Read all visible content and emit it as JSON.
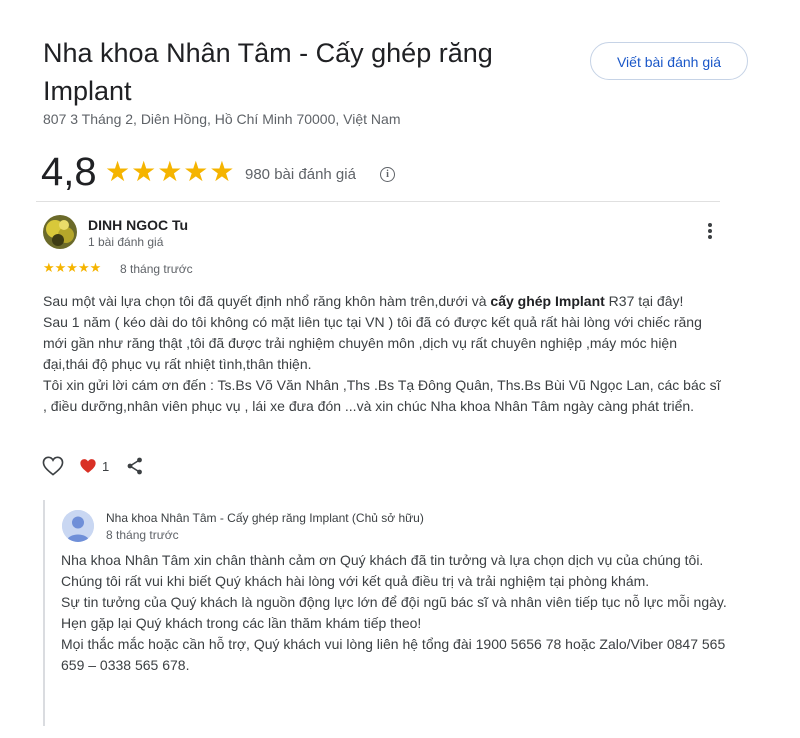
{
  "place": {
    "title": "Nha khoa Nhân Tâm - Cấy ghép răng Implant",
    "address": "807 3 Tháng 2, Diên Hồng, Hồ Chí Minh 70000, Việt Nam",
    "rating": "4,8",
    "stars": "★★★★★",
    "review_count": "980 bài đánh giá",
    "write_review_label": "Viết bài đánh giá",
    "info_glyph": "i"
  },
  "review": {
    "author": "DINH NGOC Tu",
    "author_meta": "1 bài đánh giá",
    "stars": "★★★★★",
    "rating_value": 5,
    "date": "8 tháng trước",
    "text_part1": "Sau một vài lựa chọn tôi đã quyết định nhổ răng khôn hàm trên,dưới và ",
    "text_bold": "cấy ghép Implant",
    "text_part2": " R37 tại đây!",
    "text_line2": "Sau 1 năm ( kéo dài do tôi không có mặt liên tục tại VN ) tôi đã có được kết quả rất hài lòng với chiếc răng mới gần như răng thật ,tôi đã được trải nghiệm chuyên môn ,dịch vụ rất chuyên nghiệp ,máy móc hiện đại,thái độ phục vụ rất nhiệt tình,thân thiện.",
    "text_line3": "Tôi xin gửi lời cám ơn đến : Ts.Bs Võ Văn Nhân ,Ths .Bs Tạ Đông Quân, Ths.Bs Bùi Vũ Ngọc Lan, các bác sĩ , điều dưỡng,nhân viên phục vụ , lái xe đưa đón ...và xin chúc Nha khoa Nhân Tâm ngày càng phát triển.",
    "like_count": "1"
  },
  "owner_reply": {
    "author": "Nha khoa Nhân Tâm - Cấy ghép răng Implant (Chủ sở hữu)",
    "date": "8 tháng trước",
    "lines": [
      "Nha khoa Nhân Tâm xin chân thành cảm ơn Quý khách đã tin tưởng và lựa chọn dịch vụ của chúng tôi.",
      "Chúng tôi rất vui khi biết Quý khách hài lòng với kết quả điều trị và trải nghiệm tại phòng khám.",
      "Sự tin tưởng của Quý khách là nguồn động lực lớn để đội ngũ bác sĩ và nhân viên tiếp tục nỗ lực mỗi ngày.",
      "Hẹn gặp lại Quý khách trong các lần thăm khám tiếp theo!",
      "Mọi thắc mắc hoặc cần hỗ trợ, Quý khách vui lòng liên hệ tổng đài 1900 5656 78 hoặc Zalo/Viber 0847 565 659 – 0338 565 678."
    ]
  },
  "colors": {
    "star": "#f5b400",
    "link_blue": "#1a57c8",
    "heart_red": "#d93025"
  },
  "icons": [
    "info-icon",
    "more-vert-icon",
    "heart-outline-icon",
    "heart-filled-icon",
    "share-icon",
    "avatar",
    "owner-avatar"
  ]
}
